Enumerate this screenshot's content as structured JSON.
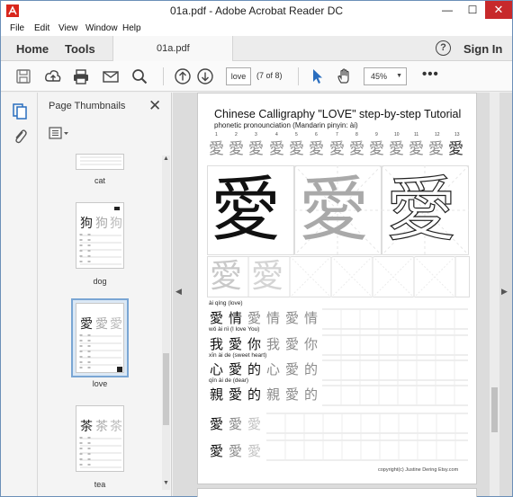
{
  "window": {
    "title": "01a.pdf - Adobe Acrobat Reader DC",
    "minimize": "—",
    "maximize": "☐",
    "close": "✕"
  },
  "menu": [
    "File",
    "Edit",
    "View",
    "Window",
    "Help"
  ],
  "tabs": {
    "home": "Home",
    "tools": "Tools",
    "document": "01a.pdf"
  },
  "header": {
    "help_icon": "?",
    "sign_in": "Sign In"
  },
  "toolbar": {
    "page_value": "love",
    "page_count": "(7 of 8)",
    "zoom": "45%",
    "zoom_arrow": "▼",
    "more": "•••",
    "icons": [
      "save-icon",
      "upload-icon",
      "print-icon",
      "email-icon",
      "search-icon",
      "previous-page-icon",
      "next-page-icon",
      "select-cursor-icon",
      "hand-tool-icon"
    ]
  },
  "left_rail": {
    "icons": [
      "page-thumbnails-icon",
      "attachments-icon"
    ]
  },
  "thumbnail_panel": {
    "title": "Page Thumbnails",
    "close": "✕",
    "thumbnails": [
      {
        "label": "cat",
        "char": ""
      },
      {
        "label": "dog",
        "char": "狗"
      },
      {
        "label": "love",
        "char": "愛"
      },
      {
        "label": "tea",
        "char": "茶"
      }
    ],
    "selected": "love"
  },
  "page": {
    "title": "Chinese Calligraphy \"LOVE\" step-by-step Tutorial",
    "subtitle": "phonetic pronounciation (Mandarin pinyin: ài)",
    "stroke_numbers": [
      "1",
      "2",
      "3",
      "4",
      "5",
      "6",
      "7",
      "8",
      "9",
      "10",
      "11",
      "12",
      "13"
    ],
    "main_char": "愛",
    "rows": [
      {
        "pinyin": "ài    qíng   (love)",
        "chars": [
          "愛",
          "情",
          "愛",
          "情",
          "愛",
          "情"
        ]
      },
      {
        "pinyin": "wǒ    ài     nǐ    (I love You)",
        "chars": [
          "我",
          "愛",
          "你",
          "我",
          "愛",
          "你"
        ]
      },
      {
        "pinyin": "xīn   ài     de    (sweet heart)",
        "chars": [
          "心",
          "愛",
          "的",
          "心",
          "愛",
          "的"
        ]
      },
      {
        "pinyin": "qīn   ài     de    (dear)",
        "chars": [
          "親",
          "愛",
          "的",
          "親",
          "愛",
          "的"
        ]
      },
      {
        "pinyin": "",
        "chars": [
          "愛",
          "愛",
          "愛"
        ]
      },
      {
        "pinyin": "",
        "chars": [
          "愛",
          "愛",
          "愛"
        ]
      }
    ],
    "copyright": "copyright(c) Justine Dering Etsy.com"
  },
  "colors": {
    "close_button": "#c7292b",
    "accent_blue": "#2a6ebf",
    "selection": "#7aa6d4"
  }
}
